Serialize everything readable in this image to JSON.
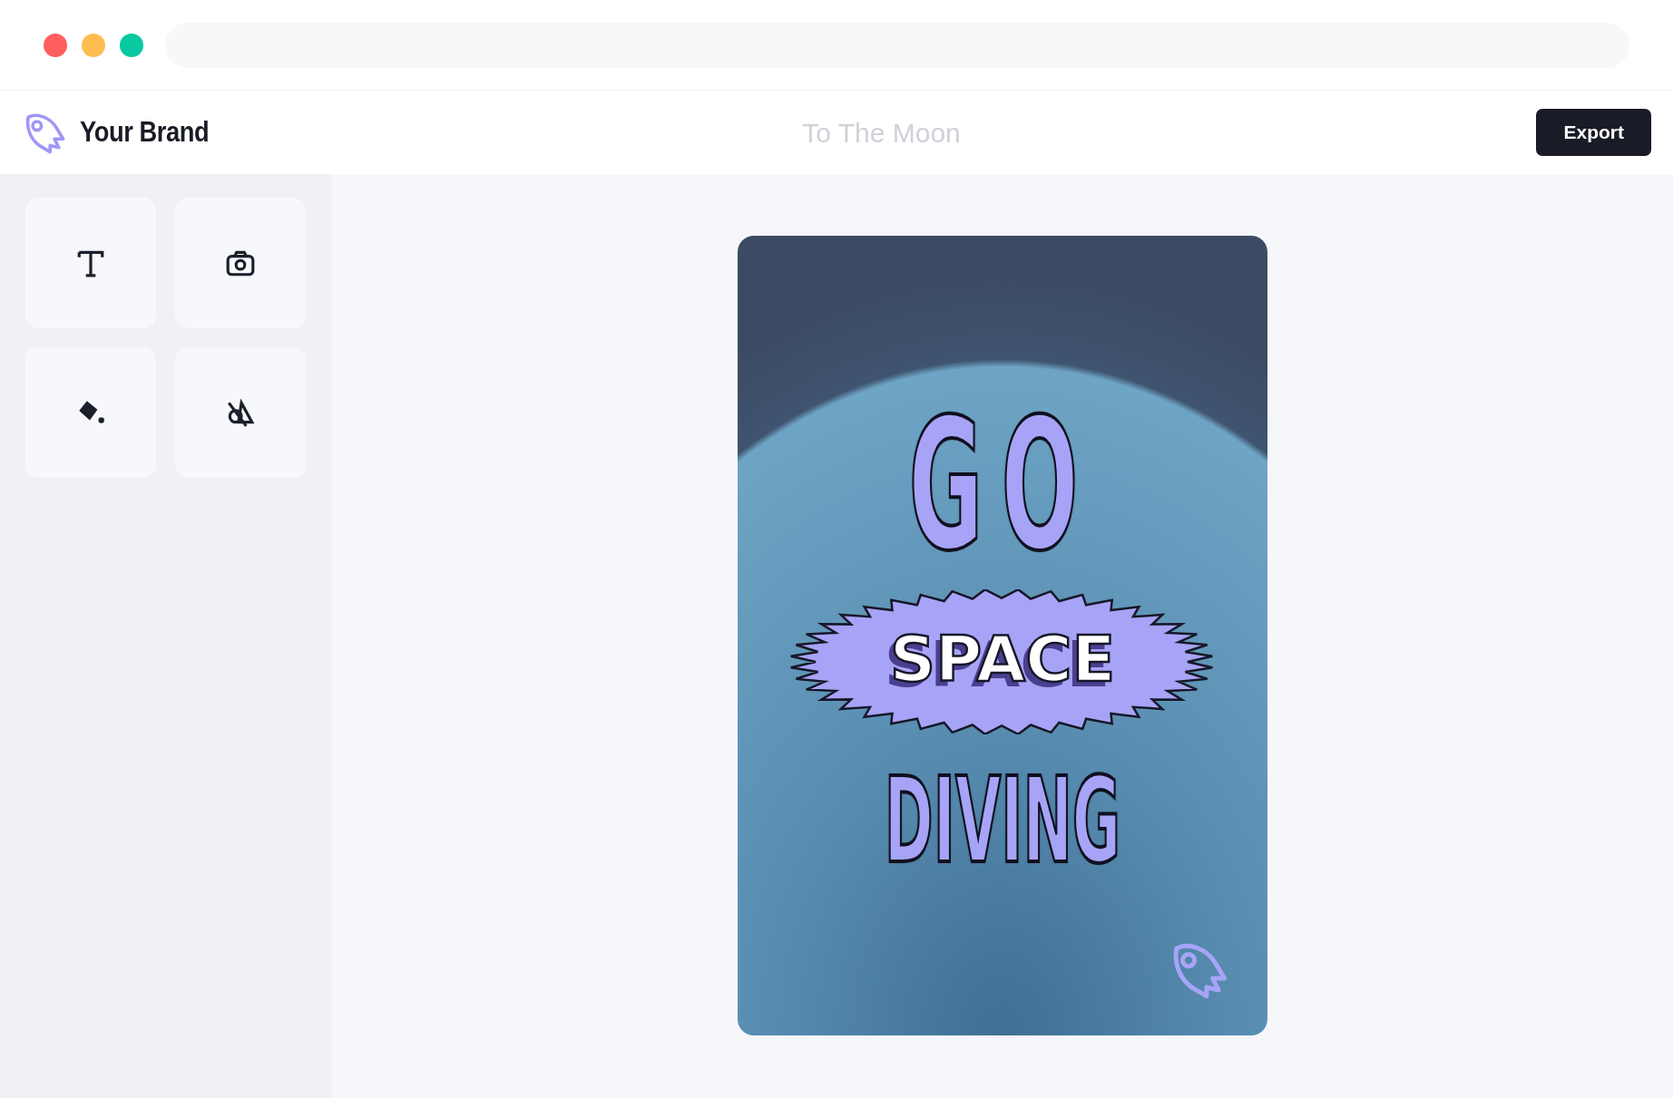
{
  "window": {
    "controls": [
      {
        "color": "#ff5f5f"
      },
      {
        "color": "#ffbd4f"
      },
      {
        "color": "#08c9a1"
      }
    ]
  },
  "header": {
    "brand": "Your Brand",
    "title_field": {
      "placeholder": "To The Moon"
    },
    "export_button": "Export"
  },
  "tools": [
    {
      "kind": "text"
    },
    {
      "kind": "photo"
    },
    {
      "kind": "fill"
    },
    {
      "kind": "shapes"
    }
  ],
  "design": {
    "headline_top": "GO",
    "burst_text": "SPACE",
    "headline_bottom": "DIVING"
  }
}
